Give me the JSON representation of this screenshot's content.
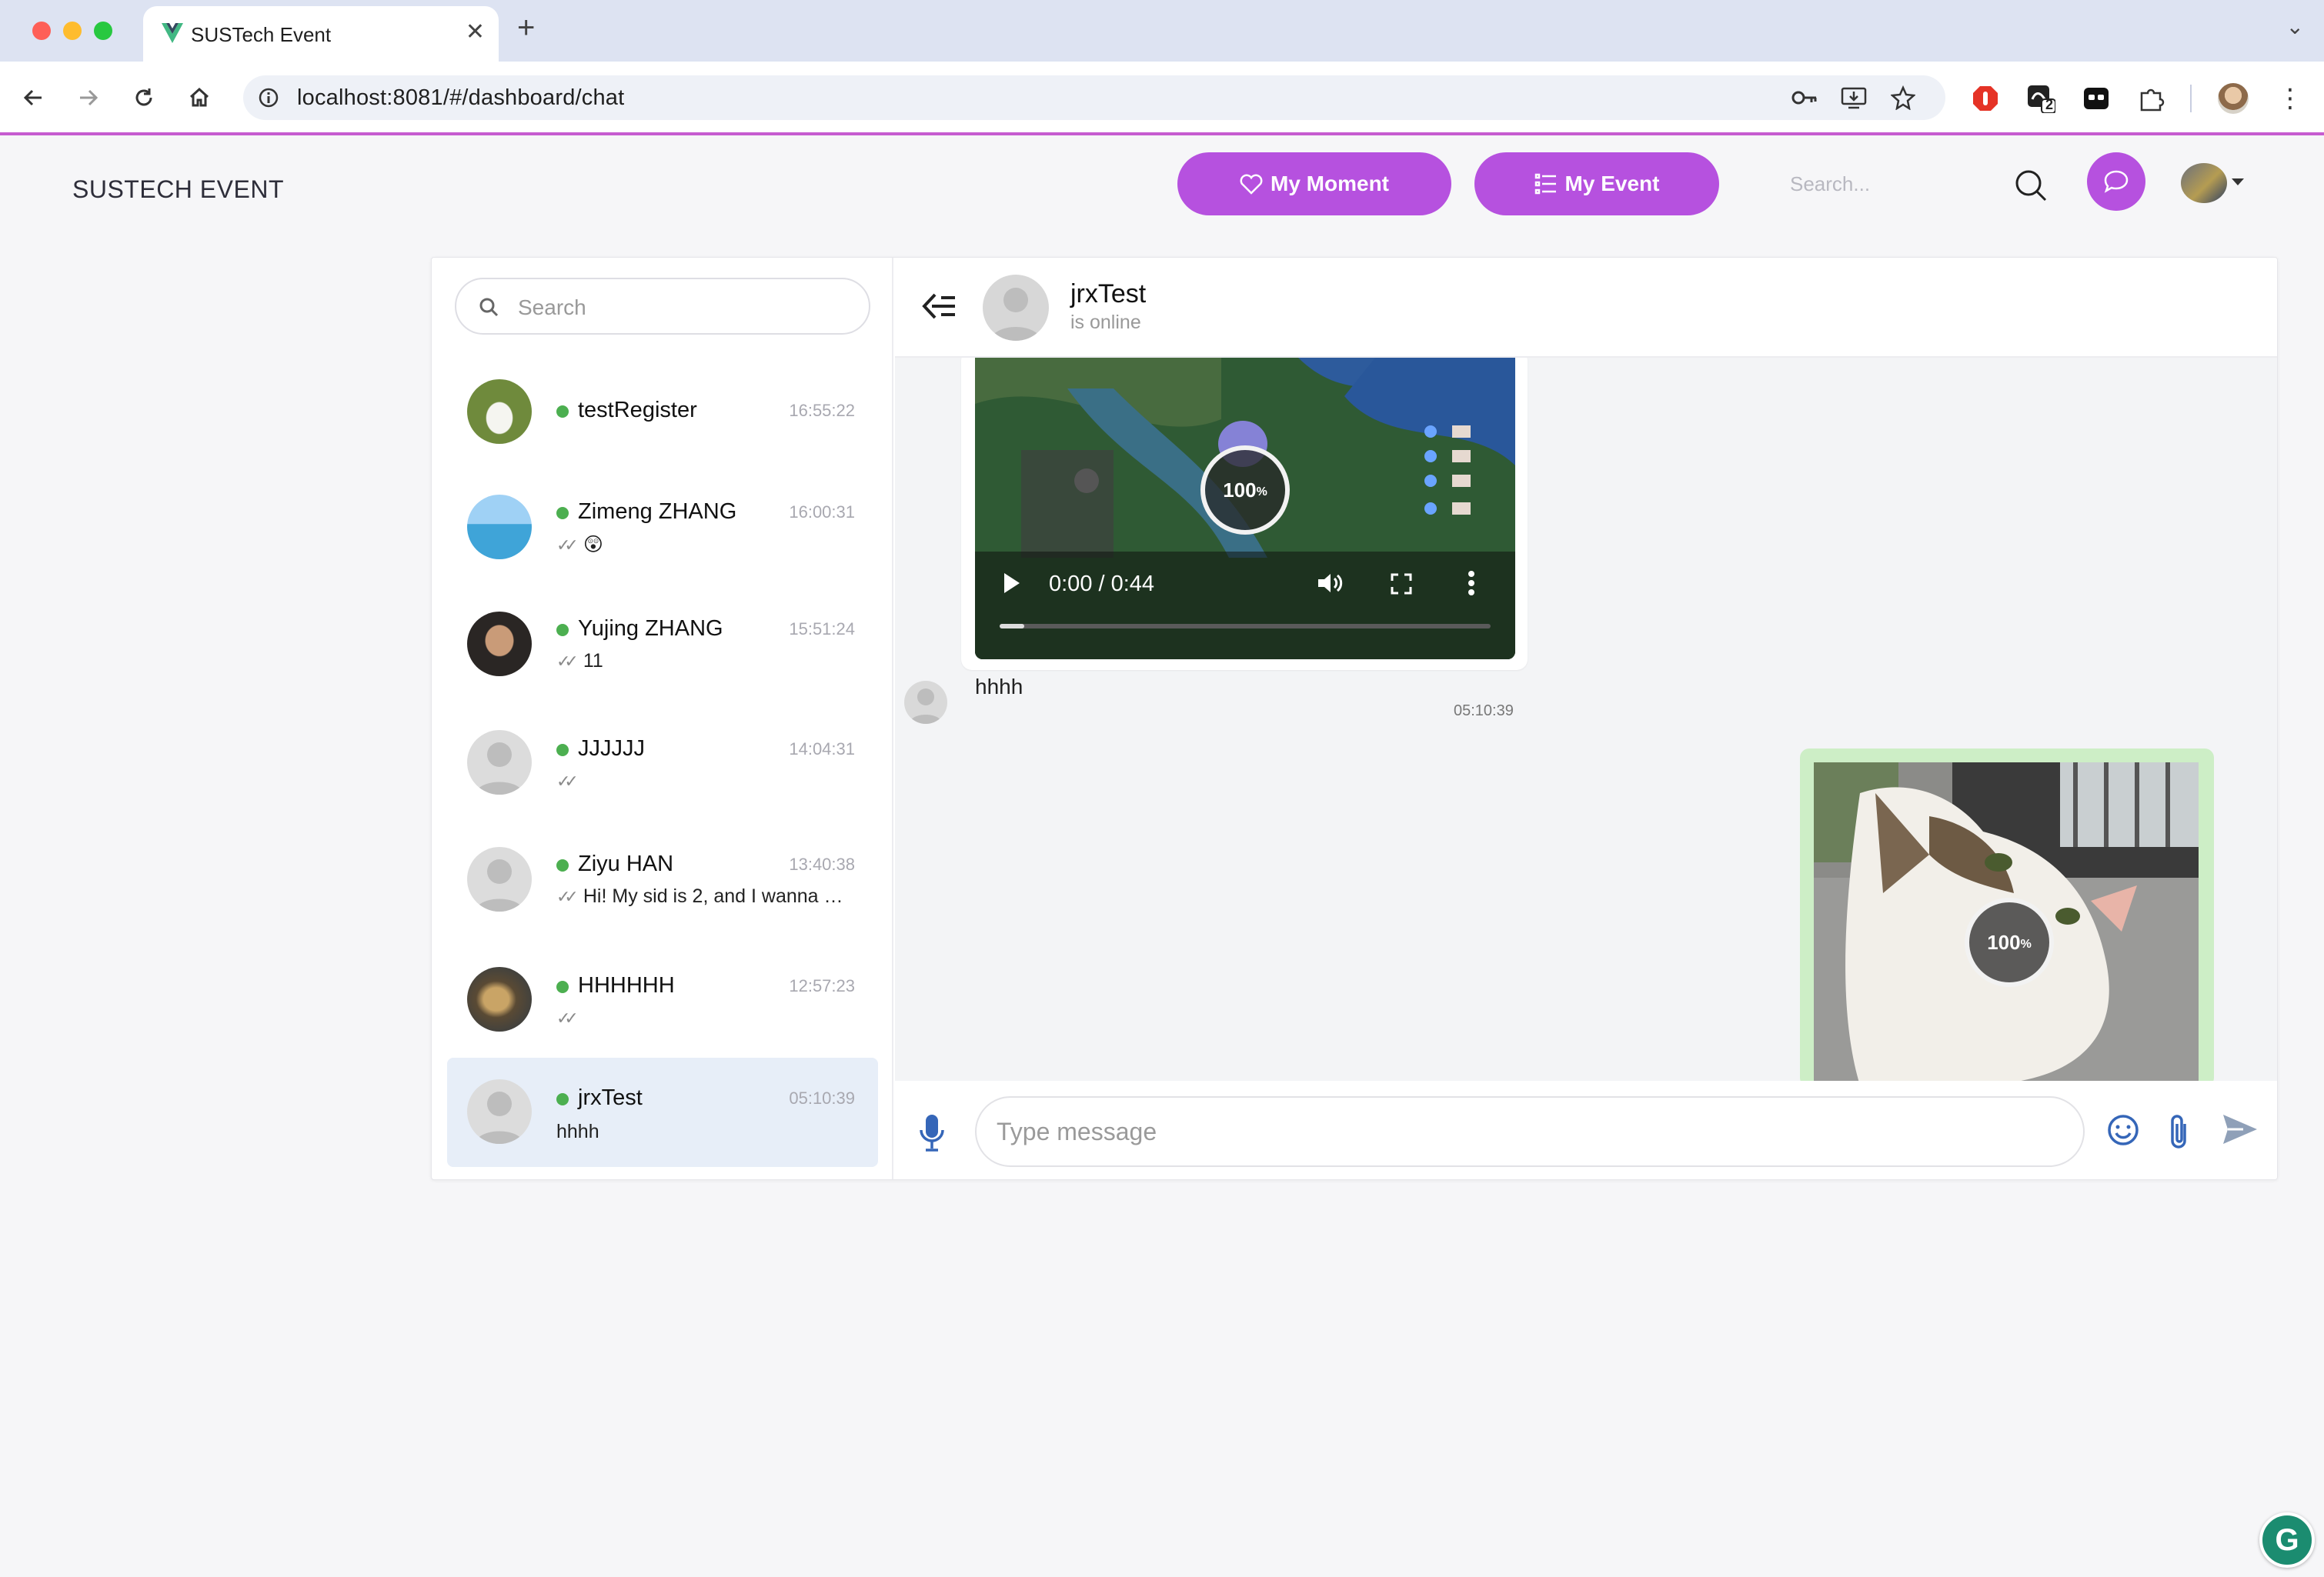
{
  "browser": {
    "tab_title": "SUSTech Event",
    "url": "localhost:8081/#/dashboard/chat",
    "extension_badge": "2"
  },
  "header": {
    "brand": "SUSTECH EVENT",
    "moment_label": "My Moment",
    "event_label": "My Event",
    "search_placeholder": "Search..."
  },
  "sidebar": {
    "search_placeholder": "Search",
    "contacts": [
      {
        "name": "testRegister",
        "time": "16:55:22",
        "last": "",
        "online": true,
        "read": false
      },
      {
        "name": "Zimeng ZHANG",
        "time": "16:00:31",
        "last": "😲",
        "online": true,
        "read": true
      },
      {
        "name": "Yujing ZHANG",
        "time": "15:51:24",
        "last": "11",
        "online": true,
        "read": true
      },
      {
        "name": "JJJJJJ",
        "time": "14:04:31",
        "last": "",
        "online": true,
        "read": true
      },
      {
        "name": "Ziyu HAN",
        "time": "13:40:38",
        "last": "Hi! My sid is 2, and I wanna ch...",
        "online": true,
        "read": true
      },
      {
        "name": "HHHHHH",
        "time": "12:57:23",
        "last": "",
        "online": true,
        "read": true
      },
      {
        "name": "jrxTest",
        "time": "05:10:39",
        "last": "hhhh",
        "online": true,
        "read": false,
        "active": true
      }
    ]
  },
  "chat": {
    "peer_name": "jrxTest",
    "peer_status": "is online",
    "messages": {
      "video": {
        "time_display": "0:00 / 0:44",
        "upload_progress": "100",
        "progress_unit": "%",
        "played_fraction": 0.05
      },
      "text": {
        "body": "hhhh",
        "time": "05:10:39"
      },
      "image": {
        "upload_progress": "100",
        "progress_unit": "%"
      }
    },
    "composer_placeholder": "Type message"
  },
  "colors": {
    "accent": "#b651df",
    "online": "#4caf50",
    "outgoing_bubble": "#cdeec6",
    "active_contact": "#e7eef8"
  },
  "icons": [
    "back-icon",
    "forward-icon",
    "reload-icon",
    "home-icon",
    "info-icon",
    "key-icon",
    "install-icon",
    "star-icon",
    "heart-icon",
    "list-icon",
    "search-icon",
    "chat-icon",
    "menu-arrow-icon",
    "play-icon",
    "volume-icon",
    "fullscreen-icon",
    "more-icon",
    "mic-icon",
    "emoji-icon",
    "attach-icon",
    "send-icon"
  ]
}
